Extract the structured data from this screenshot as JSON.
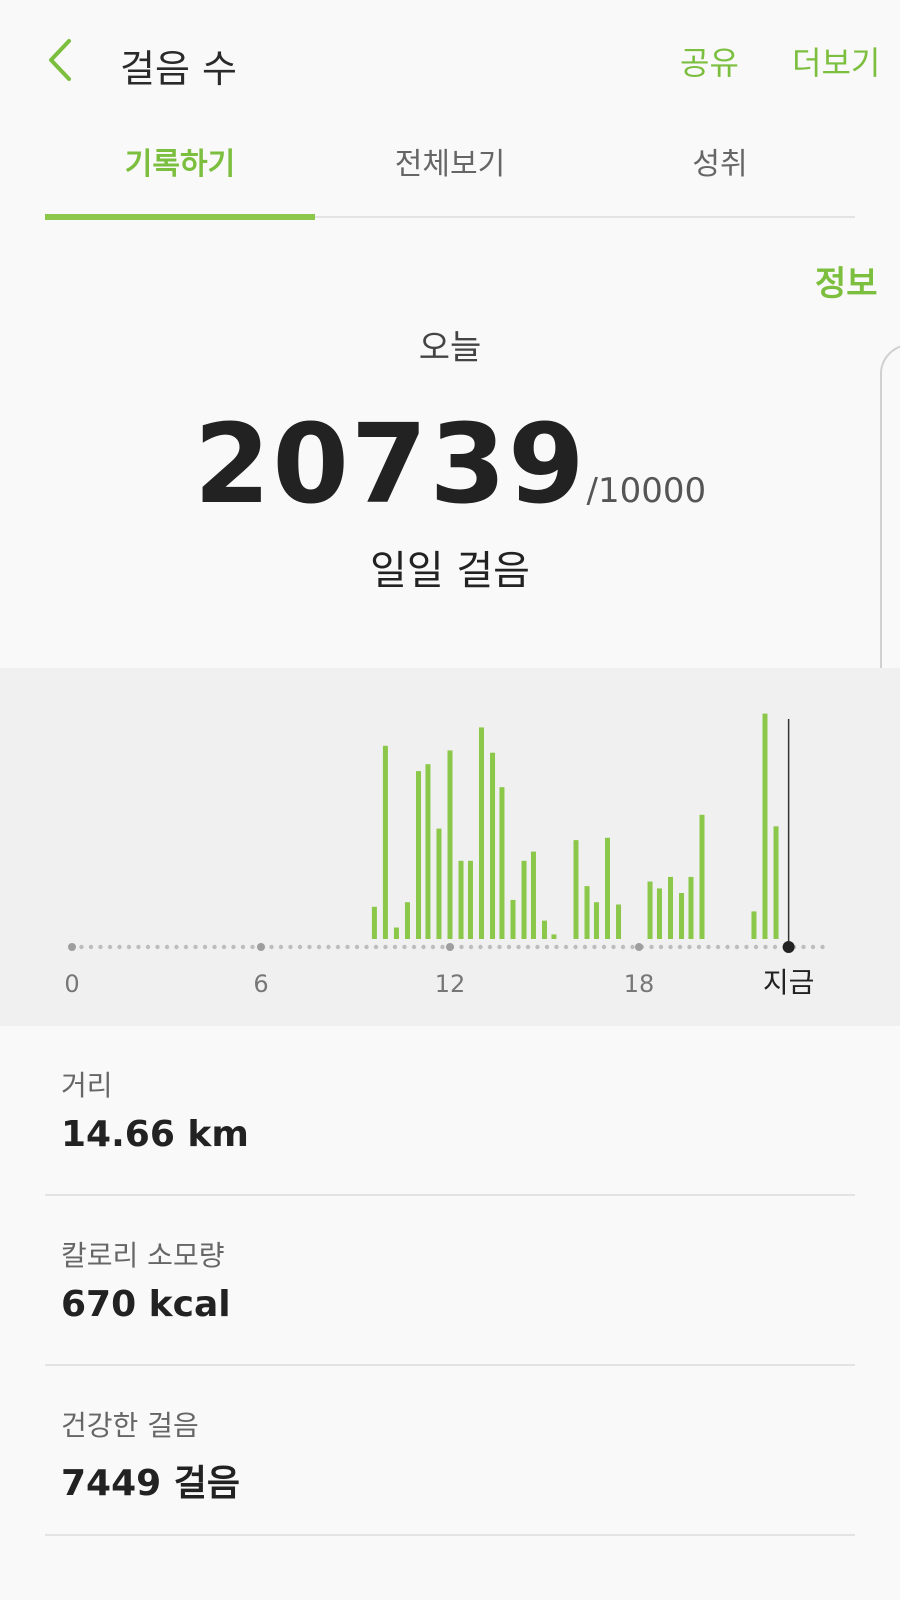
{
  "header": {
    "title": "걸음 수",
    "share_label": "공유",
    "more_label": "더보기"
  },
  "tabs": [
    {
      "label": "기록하기",
      "active": true
    },
    {
      "label": "전체보기",
      "active": false
    },
    {
      "label": "성취",
      "active": false
    }
  ],
  "info_label": "정보",
  "summary": {
    "period_label": "오늘",
    "steps": "20739",
    "goal": "/10000",
    "caption": "일일 걸음"
  },
  "chart_data": {
    "type": "bar",
    "x_ticks": [
      "0",
      "6",
      "12",
      "18",
      "지금"
    ],
    "xlim": [
      0,
      24
    ],
    "now_hour": 22.75,
    "bar_color": "#8bc84a",
    "bars": [
      {
        "hour": 9.6,
        "value": 14
      },
      {
        "hour": 9.95,
        "value": 84
      },
      {
        "hour": 10.3,
        "value": 5
      },
      {
        "hour": 10.65,
        "value": 16
      },
      {
        "hour": 11.0,
        "value": 73
      },
      {
        "hour": 11.3,
        "value": 76
      },
      {
        "hour": 11.65,
        "value": 48
      },
      {
        "hour": 12.0,
        "value": 82
      },
      {
        "hour": 12.35,
        "value": 34
      },
      {
        "hour": 12.65,
        "value": 34
      },
      {
        "hour": 13.0,
        "value": 92
      },
      {
        "hour": 13.35,
        "value": 81
      },
      {
        "hour": 13.65,
        "value": 66
      },
      {
        "hour": 14.0,
        "value": 17
      },
      {
        "hour": 14.35,
        "value": 34
      },
      {
        "hour": 14.65,
        "value": 38
      },
      {
        "hour": 15.0,
        "value": 8
      },
      {
        "hour": 15.3,
        "value": 2
      },
      {
        "hour": 16.0,
        "value": 43
      },
      {
        "hour": 16.35,
        "value": 23
      },
      {
        "hour": 16.65,
        "value": 16
      },
      {
        "hour": 17.0,
        "value": 44
      },
      {
        "hour": 17.35,
        "value": 15
      },
      {
        "hour": 18.35,
        "value": 25
      },
      {
        "hour": 18.65,
        "value": 22
      },
      {
        "hour": 19.0,
        "value": 27
      },
      {
        "hour": 19.35,
        "value": 20
      },
      {
        "hour": 19.65,
        "value": 27
      },
      {
        "hour": 20.0,
        "value": 54
      },
      {
        "hour": 21.65,
        "value": 12
      },
      {
        "hour": 22.0,
        "value": 98
      },
      {
        "hour": 22.35,
        "value": 49
      }
    ]
  },
  "stats": [
    {
      "label": "거리",
      "value": "14.66 km"
    },
    {
      "label": "칼로리 소모량",
      "value": "670 kcal"
    },
    {
      "label": "건강한 걸음",
      "value": "7449 걸음"
    }
  ],
  "colors": {
    "accent": "#7cbf3f",
    "bar": "#8bc84a",
    "background": "#f9f9f9",
    "chart_background": "#f0f0f0"
  }
}
